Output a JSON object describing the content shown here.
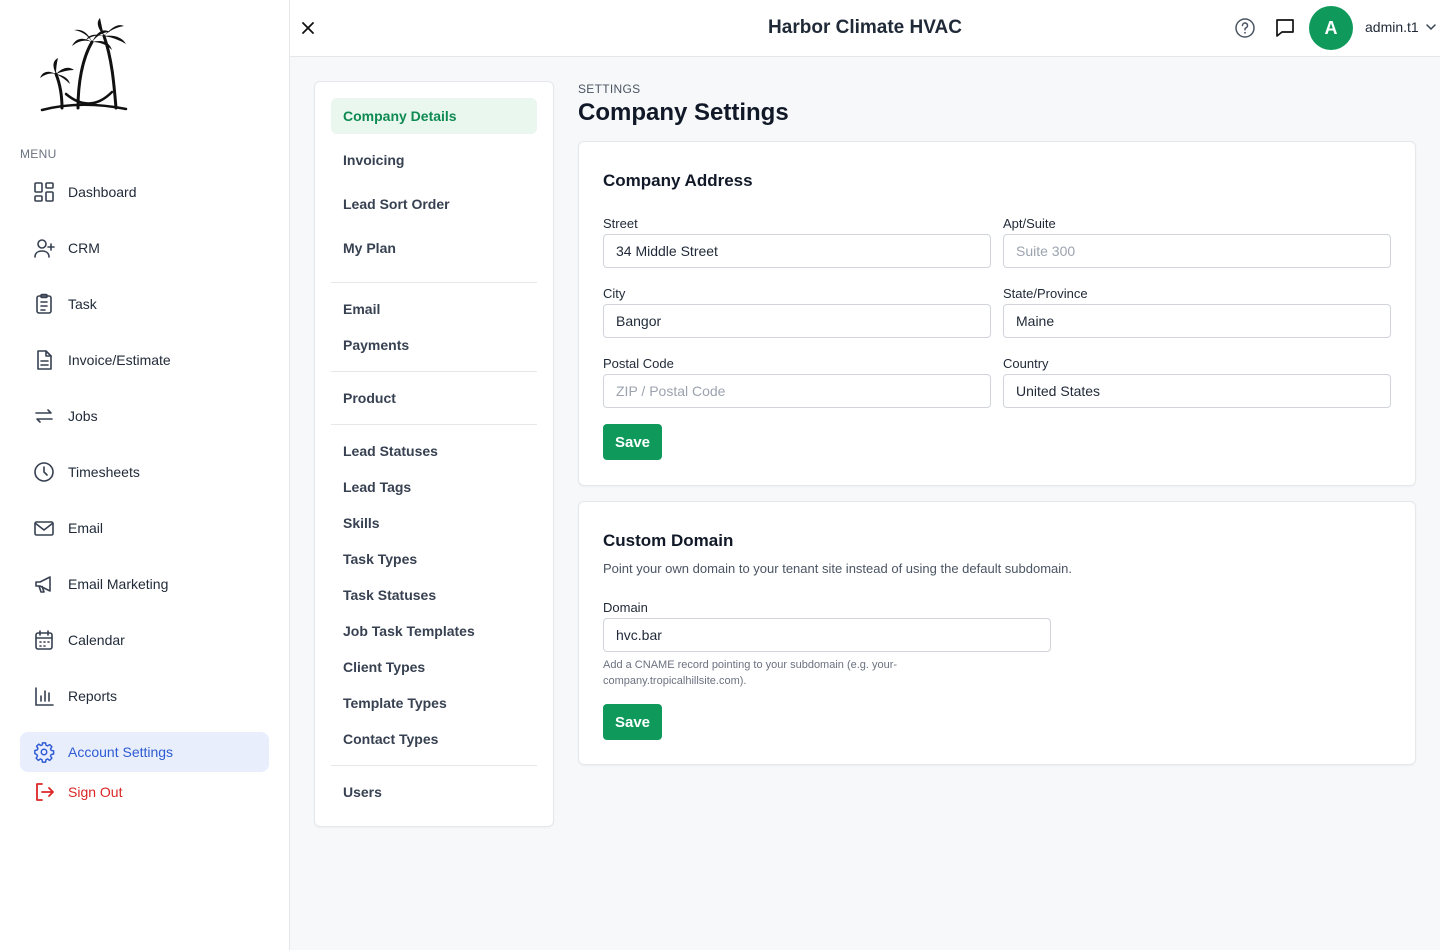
{
  "app": {
    "title": "Harbor Climate HVAC"
  },
  "user": {
    "initial": "A",
    "name": "admin.t1"
  },
  "sidebar": {
    "menu_label": "MENU",
    "items": [
      {
        "label": "Dashboard",
        "icon": "dashboard-icon"
      },
      {
        "label": "CRM",
        "icon": "user-plus-icon"
      },
      {
        "label": "Task",
        "icon": "clipboard-icon"
      },
      {
        "label": "Invoice/Estimate",
        "icon": "document-icon"
      },
      {
        "label": "Jobs",
        "icon": "repeat-icon"
      },
      {
        "label": "Timesheets",
        "icon": "clock-icon"
      },
      {
        "label": "Email",
        "icon": "mail-icon"
      },
      {
        "label": "Email Marketing",
        "icon": "megaphone-icon"
      },
      {
        "label": "Calendar",
        "icon": "calendar-icon"
      },
      {
        "label": "Reports",
        "icon": "bar-chart-icon"
      },
      {
        "label": "Account Settings",
        "icon": "gear-icon",
        "active": true
      }
    ],
    "signout_label": "Sign Out"
  },
  "settings_nav": {
    "items": [
      "Company Details",
      "Invoicing",
      "Lead Sort Order",
      "My Plan",
      "Email",
      "Payments",
      "Product",
      "Lead Statuses",
      "Lead Tags",
      "Skills",
      "Task Types",
      "Task Statuses",
      "Job Task Templates",
      "Client Types",
      "Template Types",
      "Contact Types",
      "Users"
    ],
    "active": "Company Details"
  },
  "page": {
    "breadcrumb": "SETTINGS",
    "title": "Company Settings"
  },
  "address": {
    "title": "Company Address",
    "street_label": "Street",
    "street_value": "34 Middle Street",
    "apt_label": "Apt/Suite",
    "apt_placeholder": "Suite 300",
    "city_label": "City",
    "city_value": "Bangor",
    "state_label": "State/Province",
    "state_value": "Maine",
    "postal_label": "Postal Code",
    "postal_placeholder": "ZIP / Postal Code",
    "country_label": "Country",
    "country_value": "United States",
    "save_label": "Save"
  },
  "domain": {
    "title": "Custom Domain",
    "description": "Point your own domain to your tenant site instead of using the default subdomain.",
    "domain_label": "Domain",
    "domain_value": "hvc.bar",
    "help": "Add a CNAME record pointing to your subdomain (e.g. your-company.tropicalhillsite.com).",
    "save_label": "Save"
  },
  "colors": {
    "brand_green": "#0f9a5c",
    "active_blue": "#2f5bd3",
    "active_blue_bg": "#e8eefc",
    "signout_red": "#dc2626"
  }
}
